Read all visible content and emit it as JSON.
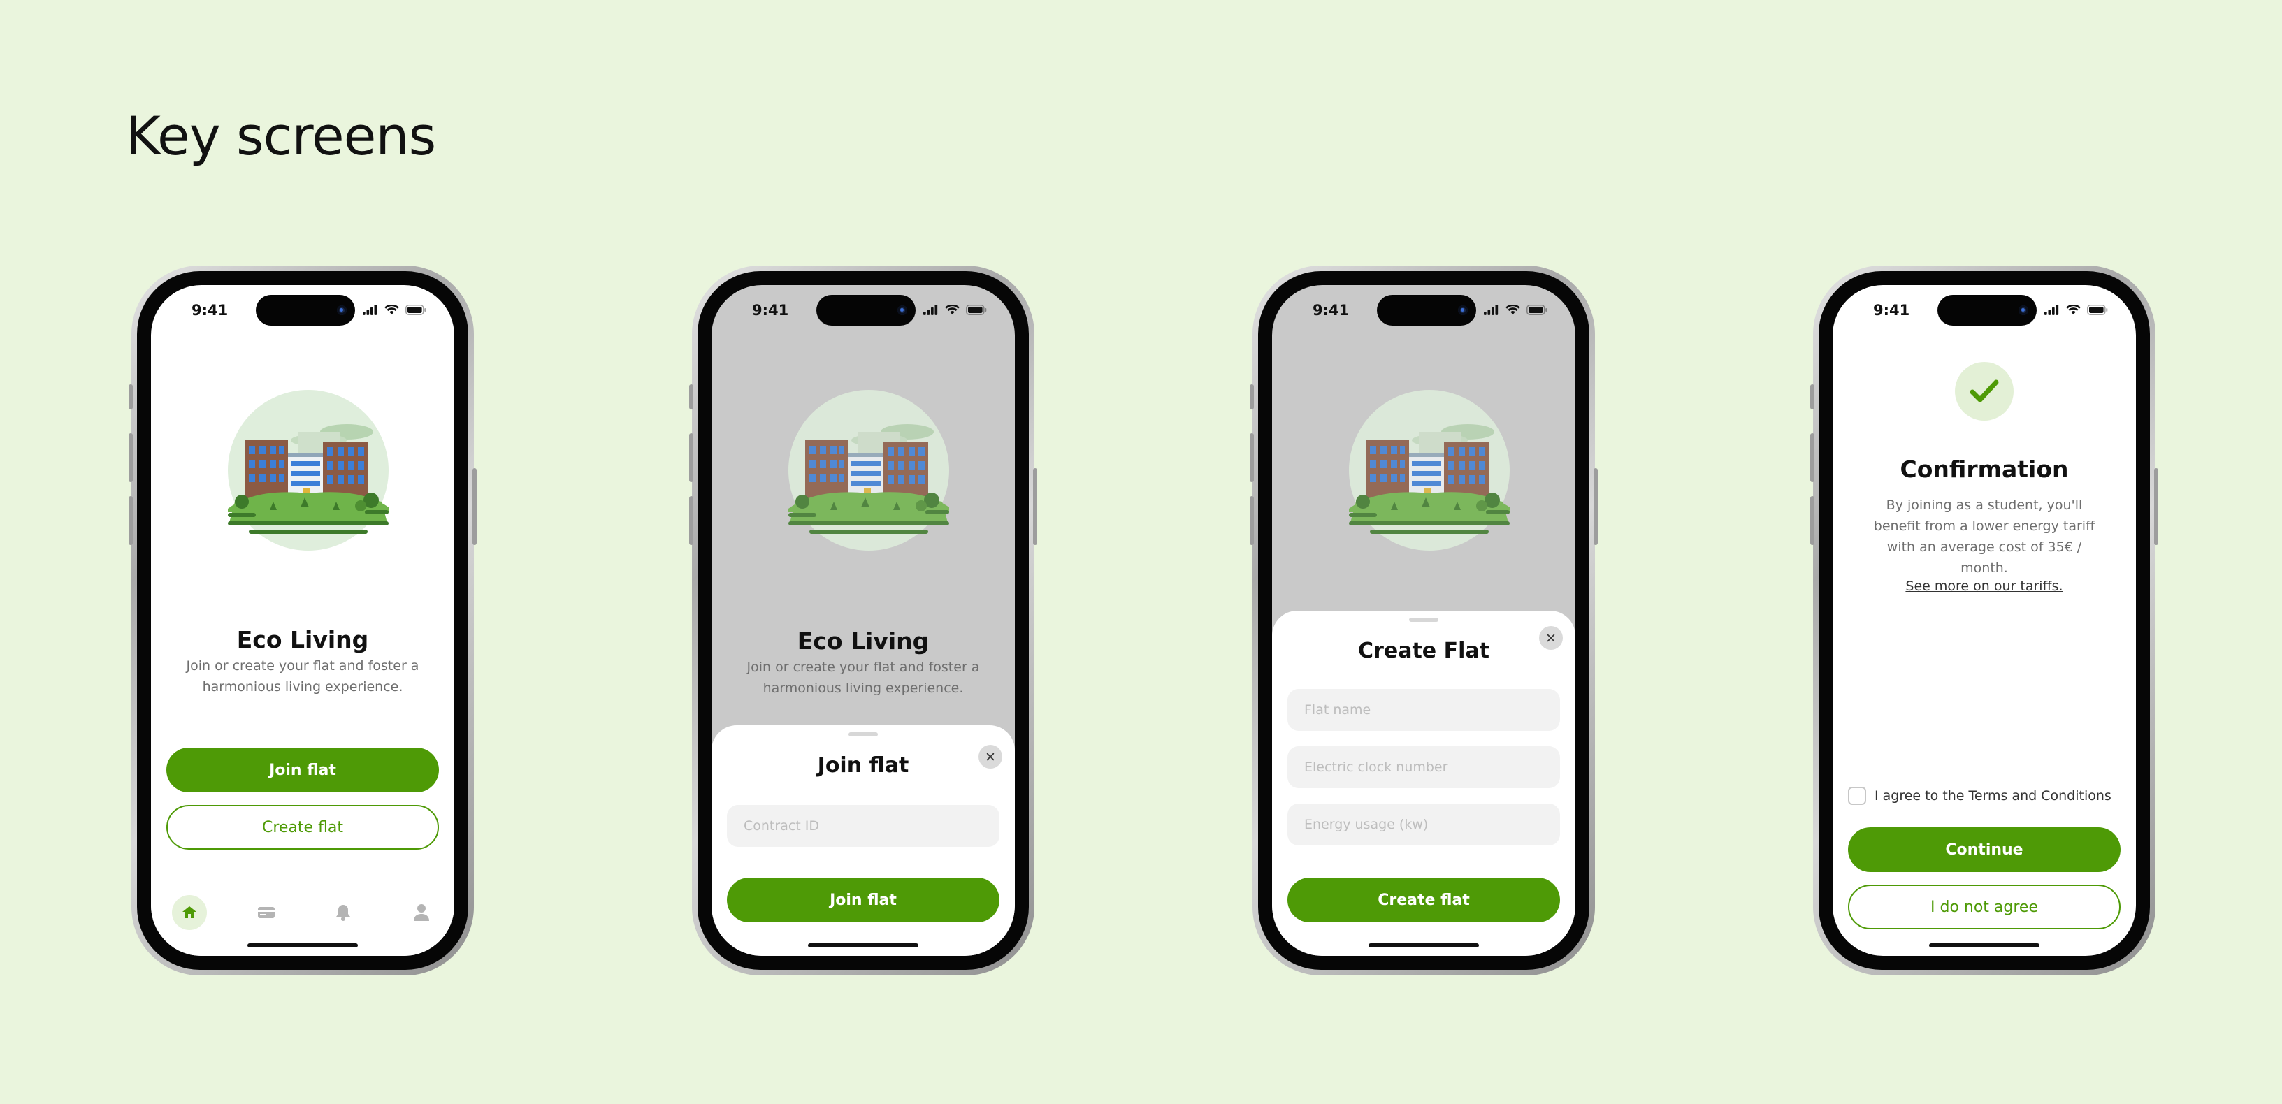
{
  "page_title": "Key screens",
  "colors": {
    "background": "#eaf5dd",
    "accent": "#4e9a06",
    "accent_light": "#e3f0d6",
    "text": "#111111",
    "muted": "#6e6e6e"
  },
  "status_bar": {
    "time": "9:41",
    "icons": [
      "signal-icon",
      "wifi-icon",
      "battery-icon"
    ]
  },
  "screen1": {
    "title": "Eco Living",
    "description": "Join or create your flat and foster a harmonious living experience.",
    "join_button": "Join flat",
    "create_button": "Create flat",
    "tabs": [
      {
        "icon": "home-icon",
        "active": true
      },
      {
        "icon": "card-icon",
        "active": false
      },
      {
        "icon": "bell-icon",
        "active": false
      },
      {
        "icon": "user-icon",
        "active": false
      }
    ]
  },
  "screen2": {
    "title": "Eco Living",
    "description": "Join or create your flat and foster a harmonious living experience.",
    "sheet_title": "Join flat",
    "contract_placeholder": "Contract ID",
    "submit_button": "Join flat"
  },
  "screen3": {
    "sheet_title": "Create Flat",
    "flat_name_placeholder": "Flat name",
    "clock_placeholder": "Electric clock number",
    "energy_placeholder": "Energy usage (kw)",
    "submit_button": "Create flat"
  },
  "screen4": {
    "title": "Confirmation",
    "description": "By joining as a student,  you'll benefit from a lower energy tariff with an average cost of 35€ / month.",
    "tariff_link": "See more on our tariffs.",
    "agree_prefix": "I agree to the",
    "terms_link": "Terms and Conditions",
    "continue_button": "Continue",
    "decline_button": "I do not agree"
  }
}
